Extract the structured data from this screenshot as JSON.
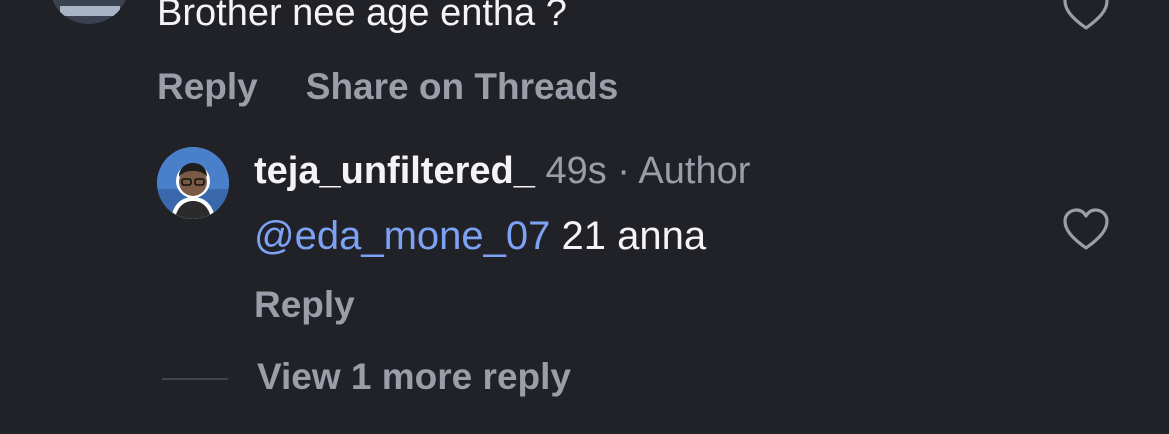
{
  "parent_comment": {
    "text": "Brother nee age entha ?",
    "actions": {
      "reply_label": "Reply",
      "share_label": "Share on Threads"
    },
    "like_icon": "heart-outline-icon"
  },
  "reply": {
    "username": "teja_unfiltered_",
    "time": "49s",
    "separator": "·",
    "role_badge": "Author",
    "mention": "@eda_mone_07",
    "text": "21 anna",
    "reply_label": "Reply",
    "like_icon": "heart-outline-icon"
  },
  "view_more": {
    "label": "View 1 more reply"
  },
  "colors": {
    "background": "#212227",
    "primary_text": "#f4f4f6",
    "secondary_text": "#9a9ea8",
    "mention": "#7da2f5"
  }
}
